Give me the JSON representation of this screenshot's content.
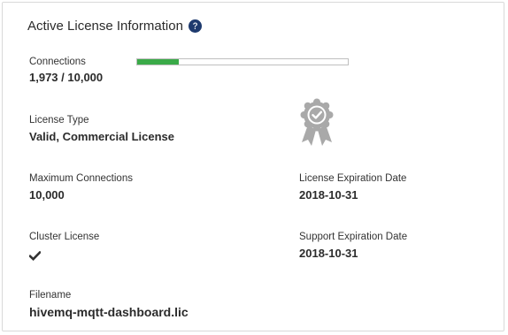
{
  "panel": {
    "title": "Active License Information",
    "help_icon": "question-circle-icon"
  },
  "connections": {
    "label": "Connections",
    "value_text": "1,973 / 10,000",
    "progress_fraction": 0.1973,
    "bar_color": "#3aaa48"
  },
  "license_type": {
    "label": "License Type",
    "value": "Valid, Commercial License",
    "icon": "certificate-badge-icon"
  },
  "maximum_connections": {
    "label": "Maximum Connections",
    "value": "10,000"
  },
  "license_expiration": {
    "label": "License Expiration Date",
    "value": "2018-10-31"
  },
  "cluster_license": {
    "label": "Cluster License",
    "icon": "checkmark-icon",
    "enabled": true
  },
  "support_expiration": {
    "label": "Support Expiration Date",
    "value": "2018-10-31"
  },
  "filename": {
    "label": "Filename",
    "value": "hivemq-mqtt-dashboard.lic"
  }
}
